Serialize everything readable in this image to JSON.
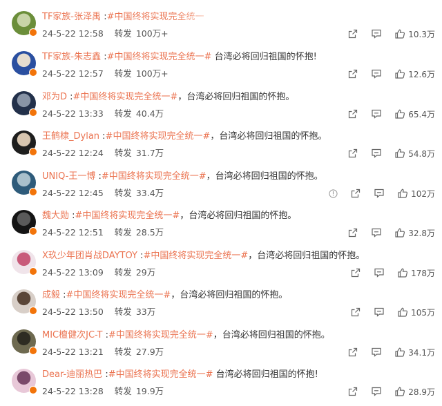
{
  "posts": [
    {
      "user": "TF家族-张泽禹",
      "text": "#中国终将实现完全统一",
      "topic_only": true,
      "time": "24-5-22 12:58",
      "repost_label": "转发",
      "reposts": "100万+",
      "likes": "10.3万",
      "avatar_colors": [
        "#6b8e3a",
        "#c8d4a8"
      ]
    },
    {
      "user": "TF家族-朱志鑫",
      "text": "#中国终将实现完全统一#",
      "tail": " 台湾必将回归祖国的怀抱!",
      "time": "24-5-22 12:57",
      "repost_label": "转发",
      "reposts": "100万+",
      "likes": "12.6万",
      "avatar_colors": [
        "#2a4fa0",
        "#e6ddcf"
      ]
    },
    {
      "user": "邓为D",
      "text": "#中国终将实现完全统一#",
      "tail": "，台湾必将回归祖国的怀抱。",
      "time": "24-5-22 13:33",
      "repost_label": "转发",
      "reposts": "40.4万",
      "likes": "65.4万",
      "avatar_colors": [
        "#22304a",
        "#8894a6"
      ]
    },
    {
      "user": "王鹤棣_Dylan",
      "text": "#中国终将实现完全统一#",
      "tail": "，台湾必将回归祖国的怀抱。",
      "time": "24-5-22 12:24",
      "repost_label": "转发",
      "reposts": "31.7万",
      "likes": "54.8万",
      "avatar_colors": [
        "#1e1e1e",
        "#d8c6b0"
      ]
    },
    {
      "user": "UNIQ-王一博",
      "text": "#中国终将实现完全统一#",
      "tail": "，台湾必将回归祖国的怀抱。",
      "time": "24-5-22 12:45",
      "repost_label": "转发",
      "reposts": "33.4万",
      "likes": "102万",
      "has_info": true,
      "avatar_colors": [
        "#2e5b7a",
        "#a9c0cc"
      ]
    },
    {
      "user": "魏大勋",
      "text": "#中国终将实现完全统一#",
      "tail": "，台湾必将回归祖国的怀抱。",
      "time": "24-5-22 12:51",
      "repost_label": "转发",
      "reposts": "28.5万",
      "likes": "32.8万",
      "avatar_colors": [
        "#141414",
        "#5a5a5a"
      ]
    },
    {
      "user": "X玖少年团肖战DAYTOY",
      "text": "#中国终将实现完全统一#",
      "tail": "，台湾必将回归祖国的怀抱。",
      "time": "24-5-22 13:09",
      "repost_label": "转发",
      "reposts": "29万",
      "likes": "178万",
      "avatar_colors": [
        "#f0e4ea",
        "#c85a7a"
      ]
    },
    {
      "user": "成毅",
      "text": "#中国终将实现完全统一#",
      "tail": "，台湾必将回归祖国的怀抱。",
      "time": "24-5-22 13:50",
      "repost_label": "转发",
      "reposts": "33万",
      "likes": "105万",
      "avatar_colors": [
        "#d8cfc8",
        "#5a4638"
      ]
    },
    {
      "user": "MIC檀健次JC-T",
      "text": "#中国终将实现完全统一#",
      "tail": "，台湾必将回归祖国的怀抱。",
      "time": "24-5-22 13:21",
      "repost_label": "转发",
      "reposts": "27.9万",
      "likes": "34.1万",
      "avatar_colors": [
        "#6e6a50",
        "#2e2c22"
      ]
    },
    {
      "user": "Dear-迪丽热巴",
      "text": "#中国终将实现完全统一#",
      "tail": " 台湾必将回归祖国的怀抱!",
      "time": "24-5-22 13:28",
      "repost_label": "转发",
      "reposts": "19.9万",
      "likes": "28.9万",
      "avatar_colors": [
        "#e8c8d8",
        "#7a4a6a"
      ]
    }
  ],
  "colors": {
    "accent": "#eb7350",
    "badge": "#f2740a",
    "icon": "#666666"
  },
  "icons": [
    "share-icon",
    "comment-icon",
    "like-icon",
    "info-icon",
    "verified-badge-icon"
  ]
}
